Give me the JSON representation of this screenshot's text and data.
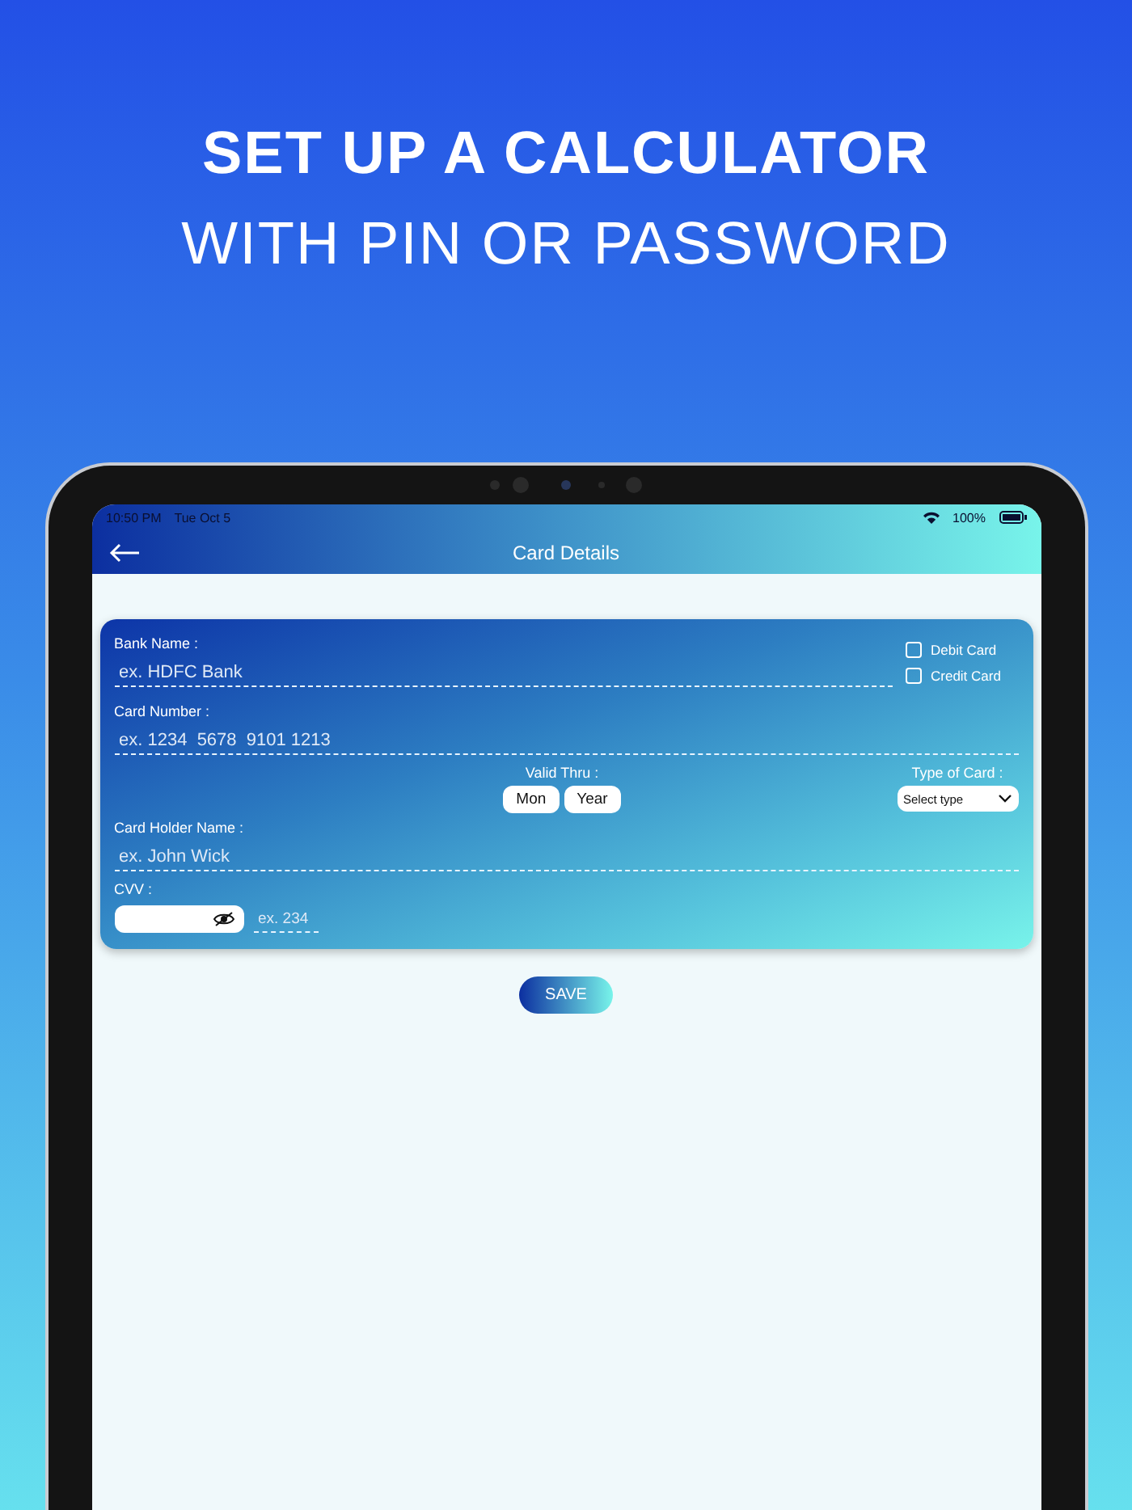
{
  "headline": {
    "line_1": "SET UP A CALCULATOR",
    "line_2": "WITH PIN OR PASSWORD"
  },
  "status_bar": {
    "time": "10:50 PM",
    "date": "Tue Oct 5",
    "battery": "100%"
  },
  "nav_bar": {
    "title": "Card Details"
  },
  "form": {
    "bank_name": {
      "label": "Bank Name :",
      "placeholder": "ex. HDFC Bank"
    },
    "card_options": [
      {
        "label": "Debit Card",
        "checked": false
      },
      {
        "label": "Credit Card",
        "checked": false
      }
    ],
    "card_number": {
      "label": "Card Number :",
      "placeholder": "ex. 1234  5678  9101 1213"
    },
    "valid_thru": {
      "label": "Valid Thru :",
      "buttons": [
        "Mon",
        "Year"
      ]
    },
    "type_of_card": {
      "label": "Type of Card :",
      "value": "Select type"
    },
    "holder_name": {
      "label": "Card Holder Name :",
      "placeholder": "ex. John Wick"
    },
    "cvv": {
      "label": "CVV :",
      "placeholder": "ex. 234"
    }
  },
  "save_button": "SAVE"
}
